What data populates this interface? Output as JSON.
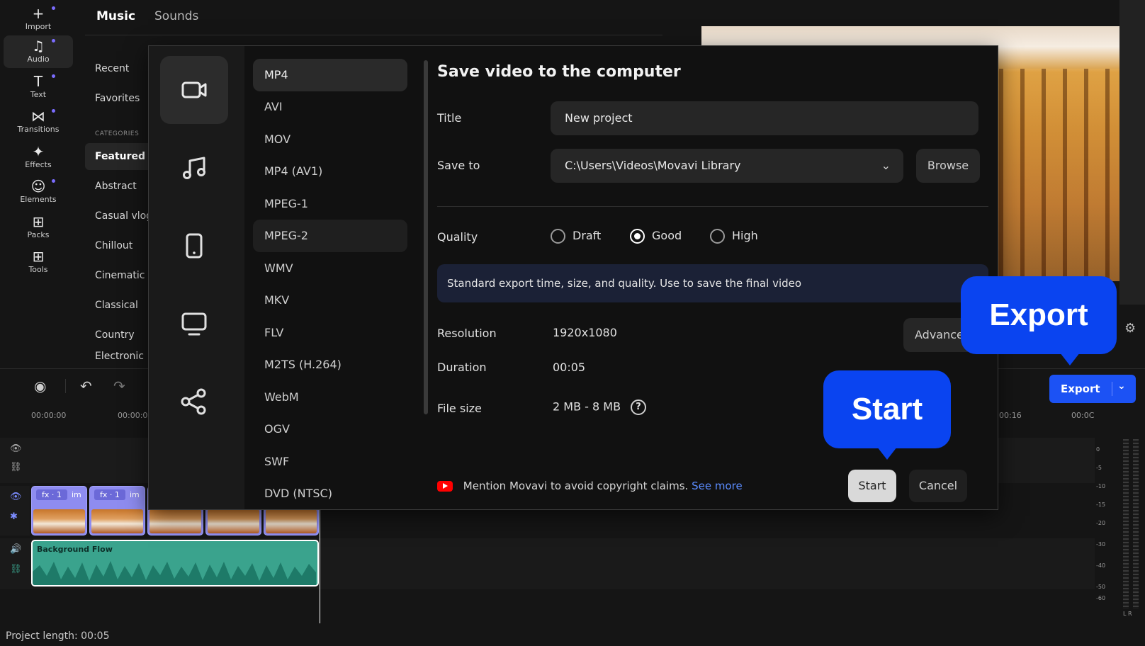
{
  "toolbar": {
    "items": [
      {
        "label": "Import",
        "icon": "plus-icon"
      },
      {
        "label": "Audio",
        "icon": "music-note-icon"
      },
      {
        "label": "Text",
        "icon": "text-icon"
      },
      {
        "label": "Transitions",
        "icon": "transitions-icon"
      },
      {
        "label": "Effects",
        "icon": "effects-icon"
      },
      {
        "label": "Elements",
        "icon": "elements-icon"
      },
      {
        "label": "Packs",
        "icon": "packs-icon"
      },
      {
        "label": "Tools",
        "icon": "tools-icon"
      }
    ]
  },
  "library": {
    "tabs": [
      "Music",
      "Sounds"
    ],
    "recent": "Recent",
    "favorites": "Favorites",
    "categories_heading": "CATEGORIES",
    "categories": [
      "Featured",
      "Abstract",
      "Casual vlog",
      "Chillout",
      "Cinematic",
      "Classical",
      "Country",
      "Electronic"
    ]
  },
  "timeline": {
    "ticks": [
      "00:00:00",
      "00:00:0",
      "00:16",
      "00:0C"
    ],
    "clip_fx": "fx · 1",
    "clip_name": "im",
    "audio_clip": "Background Flow",
    "project_length": "Project length: 00:05",
    "export_label": "Export"
  },
  "meter": {
    "labels": [
      "0",
      "-5",
      "-10",
      "-15",
      "-20",
      "-30",
      "-40",
      "-50",
      "-60"
    ],
    "channels": "L  R"
  },
  "dialog": {
    "title": "Save video to the computer",
    "formats": [
      "MP4",
      "AVI",
      "MOV",
      "MP4 (AV1)",
      "MPEG-1",
      "MPEG-2",
      "WMV",
      "MKV",
      "FLV",
      "M2TS (H.264)",
      "WebM",
      "OGV",
      "SWF",
      "DVD (NTSC)"
    ],
    "title_label": "Title",
    "title_value": "New project",
    "save_to_label": "Save to",
    "save_to_value": "C:\\Users\\Videos\\Movavi Library",
    "browse": "Browse",
    "quality_label": "Quality",
    "quality_options": [
      "Draft",
      "Good",
      "High"
    ],
    "quality_selected": "Good",
    "info": "Standard export time, size, and quality. Use to save the final video",
    "resolution_label": "Resolution",
    "resolution_value": "1920x1080",
    "advanced": "Advanced",
    "duration_label": "Duration",
    "duration_value": "00:05",
    "filesize_label": "File size",
    "filesize_value": "2 MB - 8 MB",
    "help": "?",
    "copyright": "Mention Movavi to avoid copyright claims.",
    "see_more": "See more",
    "start": "Start",
    "cancel": "Cancel"
  },
  "callouts": {
    "export": "Export",
    "start": "Start"
  },
  "colors": {
    "accent": "#1c52f4",
    "callout": "#0a44f0",
    "audio_clip": "#3aa38d",
    "video_clip": "#8e8cf0"
  }
}
